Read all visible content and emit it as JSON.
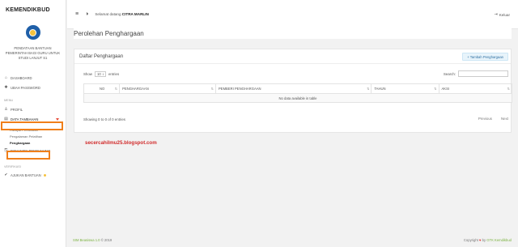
{
  "brand": "KEMENDIKBUD",
  "org_name": "PENDATAAN BANTUAN PEMERINTAH BAGI GURU UNTUK STUDI LANJUT S1",
  "sidebar": {
    "dashboard": "DASHBOARD",
    "change_password": "UBAH PASSWORD",
    "section_menu": "MENU",
    "profile": "PROFIL",
    "extra_data": "DATA TAMBAHAN",
    "sub": [
      "Riwayat Pendidikan",
      "Pengalaman Pelatihan",
      "Penghargaan"
    ],
    "documents": "DOKUMEN PENDUKUNG",
    "section_verify": "VERIFIKASI",
    "submit_aid": "AJUKAN BANTUAN"
  },
  "topbar": {
    "greeting": "Selamat datang",
    "user": "CITRA MARLIN",
    "logout": "Keluar"
  },
  "page_title": "Perolehan Penghargaan",
  "card": {
    "title": "Daftar Penghargaan",
    "add_button": "+ Tambah Penghargaan",
    "show_label": "Show",
    "entries_value": "10",
    "entries_label": "entries",
    "search_label": "Search:",
    "columns": [
      "NO",
      "PENGHARGAAN",
      "PEMBERI PENGHARGAAN",
      "TAHUN",
      "AKSI"
    ],
    "empty_text": "No data available in table",
    "info": "Showing 0 to 0 of 0 entries",
    "prev": "Previous",
    "next": "Next"
  },
  "watermark": "secercahilmu25.blogspot.com",
  "footer_left_app": "SIM Beasiswa 1.0",
  "footer_left_year": "© 2019",
  "footer_right_pre": "Copyright",
  "footer_right_by": "by",
  "footer_right_org": "GTK Kemdikbud",
  "colors": {
    "highlight": "#f07f1a",
    "watermark": "#d12b2b",
    "accent": "#7cb342"
  }
}
